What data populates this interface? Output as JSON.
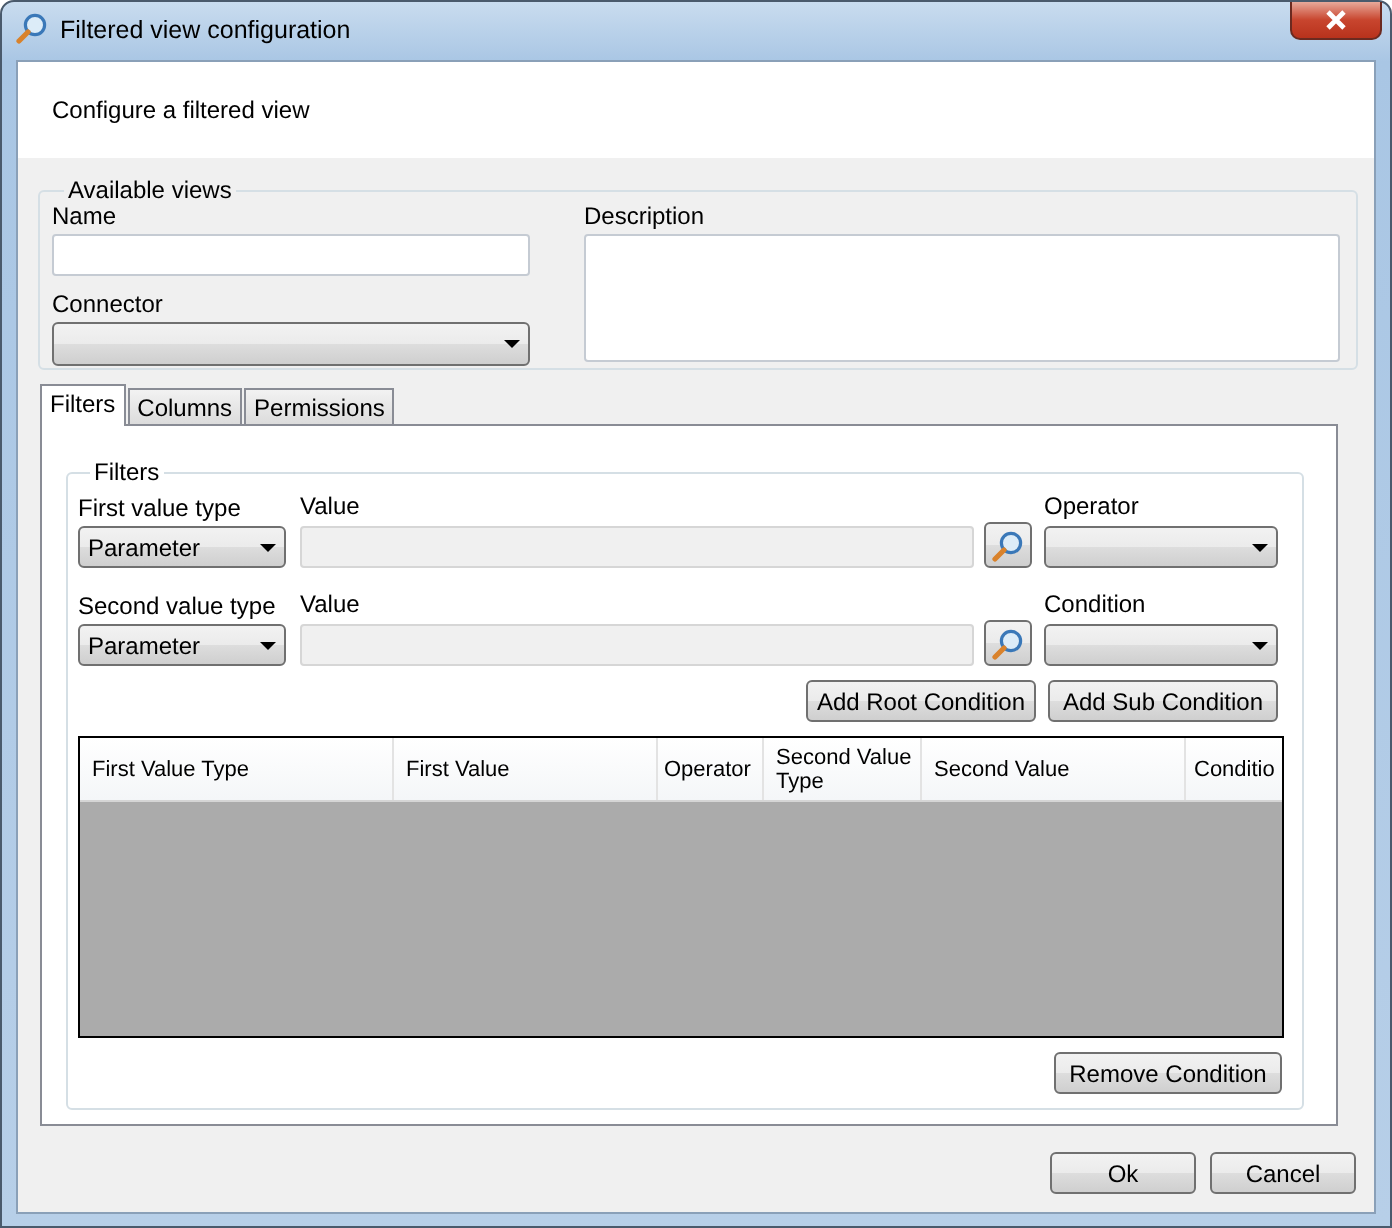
{
  "window": {
    "title": "Filtered view configuration"
  },
  "header": {
    "text": "Configure a filtered view"
  },
  "available_views": {
    "title": "Available views",
    "name": {
      "label": "Name"
    },
    "connector": {
      "label": "Connector"
    },
    "description": {
      "label": "Description"
    }
  },
  "tabs": [
    {
      "label": "Filters",
      "selected": true
    },
    {
      "label": "Columns",
      "selected": false
    },
    {
      "label": "Permissions",
      "selected": false
    }
  ],
  "filters": {
    "title": "Filters",
    "rows": [
      {
        "type_label": "First value type",
        "type_value": "Parameter",
        "value_label": "Value",
        "value_disabled": true,
        "right_label": "Operator"
      },
      {
        "type_label": "Second value type",
        "type_value": "Parameter",
        "value_label": "Value",
        "value_disabled": true,
        "right_label": "Condition"
      }
    ],
    "buttons": [
      "Add Root Condition",
      "Add Sub Condition"
    ]
  },
  "grid": {
    "columns": [
      "First Value Type",
      "First Value",
      "Operator",
      "Second Value Type",
      "Second Value",
      "Conditio"
    ]
  },
  "remove_button": "Remove Condition",
  "buttons": [
    "Ok",
    "Cancel"
  ]
}
